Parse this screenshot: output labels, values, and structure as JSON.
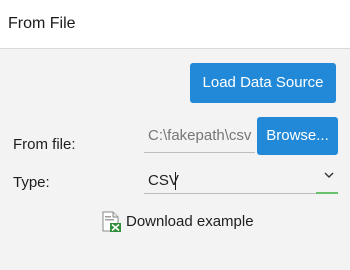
{
  "header": {
    "title": "From File"
  },
  "actions": {
    "load_label": "Load Data Source"
  },
  "form": {
    "file_label": "From file:",
    "file_path": "C:\\fakepath\\csv",
    "browse_label": "Browse...",
    "type_label": "Type:",
    "type_value": "CSV"
  },
  "download": {
    "label": "Download example",
    "icon": "csv-file-icon"
  },
  "colors": {
    "accent": "#2189d8",
    "focus_accent": "#68c26d",
    "background": "#f3f3f3"
  }
}
